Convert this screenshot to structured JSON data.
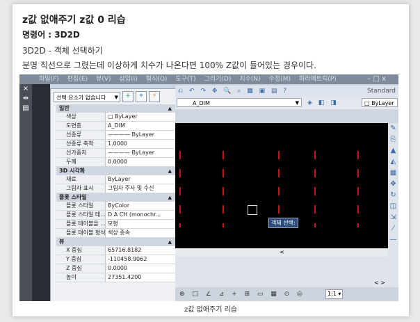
{
  "post": {
    "title": "z값 없애주기 z값 0 리습",
    "command": "명령어 : 3D2D",
    "line1": "3D2D - 객체 선택하기",
    "line2": "분명 직선으로 그렸는데 이상하게 치수가 나온다면 100% Z값이 들어있는 경우이다.",
    "caption": "z값 없애주기 리습"
  },
  "app": {
    "menu": [
      "파일(F)",
      "편집(E)",
      "뷰(V)",
      "삽입(I)",
      "형식(O)",
      "도구(T)",
      "그리기(D)",
      "치수(N)",
      "수정(M)",
      "파라메트릭(P)"
    ],
    "window_controls": "– □ x",
    "toolbar_style": "Standard",
    "layer_name": "A_DIM",
    "color_value": "ByLayer"
  },
  "palette": {
    "selection": "선택 요소가 없습니다",
    "sections": [
      {
        "name": "일반",
        "rows": [
          {
            "k": "색상",
            "v": "□ ByLayer"
          },
          {
            "k": "도면층",
            "v": "A_DIM"
          },
          {
            "k": "선종류",
            "v": "———— ByLayer"
          },
          {
            "k": "선종류 축척",
            "v": "1.0000"
          },
          {
            "k": "선가중치",
            "v": "———— ByLayer"
          },
          {
            "k": "두께",
            "v": "0.0000"
          }
        ]
      },
      {
        "name": "3D 시각화",
        "rows": [
          {
            "k": "재료",
            "v": "ByLayer"
          },
          {
            "k": "그림자 표시",
            "v": "그림자 주사 및 수신"
          }
        ]
      },
      {
        "name": "플롯 스타일",
        "rows": [
          {
            "k": "플롯 스타일",
            "v": "ByColor"
          },
          {
            "k": "플롯 스타일 테...",
            "v": "D A CH (monochr..."
          },
          {
            "k": "플롯 테이블을 ...",
            "v": "모형"
          },
          {
            "k": "플롯 테이블 형식",
            "v": "색상 종속"
          }
        ]
      },
      {
        "name": "뷰",
        "rows": [
          {
            "k": "X 중심",
            "v": "65716.8182"
          },
          {
            "k": "Y 중심",
            "v": "-110458.9062"
          },
          {
            "k": "Z 중심",
            "v": "0.0000"
          },
          {
            "k": "높이",
            "v": "27351.4200"
          }
        ]
      }
    ]
  },
  "canvas": {
    "tooltip": "객체 선택:",
    "line_color": "#c81414"
  },
  "status": {
    "scale": "1:1 ▾"
  }
}
